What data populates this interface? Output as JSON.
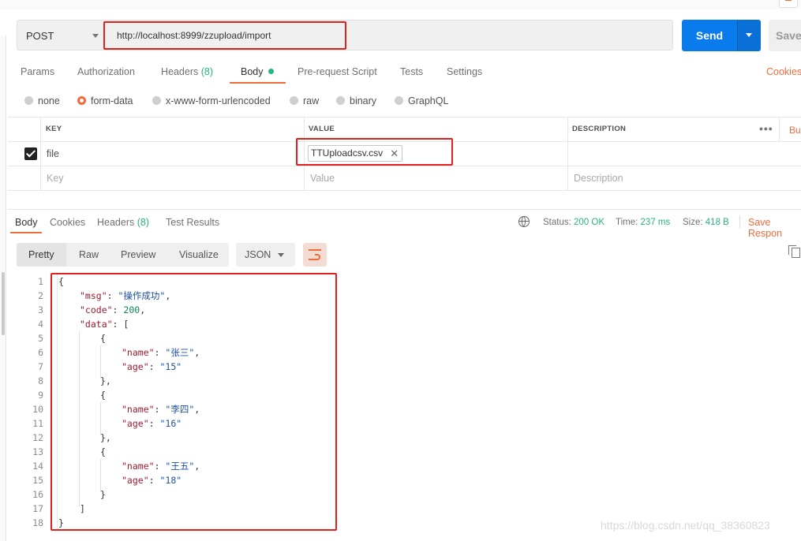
{
  "request": {
    "method": "POST",
    "url": "http://localhost:8999/zzupload/import",
    "send_label": "Send",
    "save_label": "Save"
  },
  "request_tabs": {
    "params": "Params",
    "authorization": "Authorization",
    "headers": "Headers",
    "headers_count": "(8)",
    "body": "Body",
    "prerequest": "Pre-request Script",
    "tests": "Tests",
    "settings": "Settings",
    "cookies": "Cookies"
  },
  "body_types": {
    "none": "none",
    "form_data": "form-data",
    "urlencoded": "x-www-form-urlencoded",
    "raw": "raw",
    "binary": "binary",
    "graphql": "GraphQL",
    "selected": "form-data"
  },
  "params_table": {
    "headers": {
      "key": "KEY",
      "value": "VALUE",
      "description": "DESCRIPTION",
      "bulk": "Bu"
    },
    "rows": [
      {
        "key": "file",
        "value": "TTUploadcsv.csv",
        "checked": true
      }
    ],
    "placeholders": {
      "key": "Key",
      "value": "Value",
      "description": "Description"
    }
  },
  "response_tabs": {
    "body": "Body",
    "cookies": "Cookies",
    "headers": "Headers",
    "headers_count": "(8)",
    "test_results": "Test Results"
  },
  "response_meta": {
    "status_label": "Status:",
    "status_value": "200 OK",
    "time_label": "Time:",
    "time_value": "237 ms",
    "size_label": "Size:",
    "size_value": "418 B",
    "save_response": "Save Respon"
  },
  "format_toolbar": {
    "pretty": "Pretty",
    "raw": "Raw",
    "preview": "Preview",
    "visualize": "Visualize",
    "language": "JSON"
  },
  "response_body": {
    "line_numbers": [
      "1",
      "2",
      "3",
      "4",
      "5",
      "6",
      "7",
      "8",
      "9",
      "10",
      "11",
      "12",
      "13",
      "14",
      "15",
      "16",
      "17",
      "18"
    ],
    "open_brace": "{",
    "msg_key": "\"msg\"",
    "msg_value": "\"操作成功\"",
    "code_key": "\"code\"",
    "code_value": "200",
    "data_key": "\"data\"",
    "items": [
      {
        "name_key": "\"name\"",
        "name_value": "\"张三\"",
        "age_key": "\"age\"",
        "age_value": "\"15\""
      },
      {
        "name_key": "\"name\"",
        "name_value": "\"李四\"",
        "age_key": "\"age\"",
        "age_value": "\"16\""
      },
      {
        "name_key": "\"name\"",
        "name_value": "\"王五\"",
        "age_key": "\"age\"",
        "age_value": "\"18\""
      }
    ],
    "close_bracket": "]",
    "close_brace": "}"
  },
  "watermark": "https://blog.csdn.net/qq_38360823",
  "colors": {
    "accent": "#f26b3a",
    "send_blue": "#097bed",
    "status_green": "#26b47f",
    "highlight_red": "#e0211d"
  },
  "icons": [
    "caret-down-icon",
    "globe-icon",
    "copy-icon",
    "wrap-lines-icon",
    "more-dots-icon",
    "checkbox-checked-icon",
    "close-icon"
  ]
}
